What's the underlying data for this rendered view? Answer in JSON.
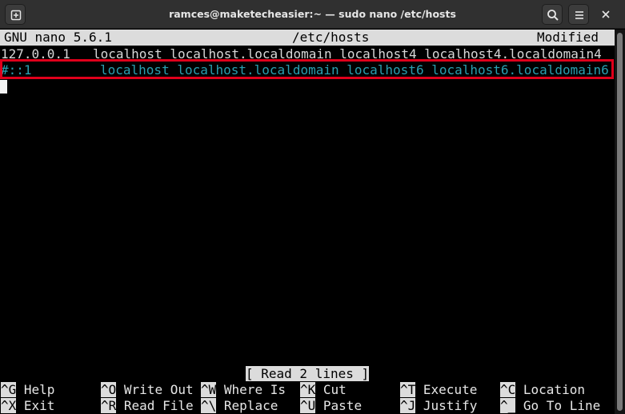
{
  "window": {
    "title": "ramces@maketecheasier:~ — sudo nano /etc/hosts"
  },
  "nano": {
    "version": "GNU nano 5.6.1",
    "filename": "/etc/hosts",
    "state": "Modified",
    "lines": [
      {
        "address": "127.0.0.1",
        "hosts": "localhost localhost.localdomain localhost4 localhost4.localdomain4"
      },
      {
        "address": "#::1",
        "hosts": "localhost localhost.localdomain localhost6 localhost6.localdomain6"
      }
    ],
    "status_message": "[ Read 2 lines ]",
    "shortcuts": [
      {
        "key": "^G",
        "label": "Help"
      },
      {
        "key": "^O",
        "label": "Write Out"
      },
      {
        "key": "^W",
        "label": "Where Is"
      },
      {
        "key": "^K",
        "label": "Cut"
      },
      {
        "key": "^T",
        "label": "Execute"
      },
      {
        "key": "^C",
        "label": "Location"
      },
      {
        "key": "^X",
        "label": "Exit"
      },
      {
        "key": "^R",
        "label": "Read File"
      },
      {
        "key": "^\\",
        "label": "Replace"
      },
      {
        "key": "^U",
        "label": "Paste"
      },
      {
        "key": "^J",
        "label": "Justify"
      },
      {
        "key": "^_",
        "label": "Go To Line"
      }
    ]
  },
  "icons": {
    "new_tab": "new-tab-icon",
    "search": "search-icon",
    "menu": "hamburger-menu-icon",
    "close": "close-icon"
  },
  "colors": {
    "comment_cyan": "#2a9fb0",
    "highlight_red": "#e0001b",
    "bar_gray": "#dcdcdc",
    "titlebar": "#303030"
  }
}
